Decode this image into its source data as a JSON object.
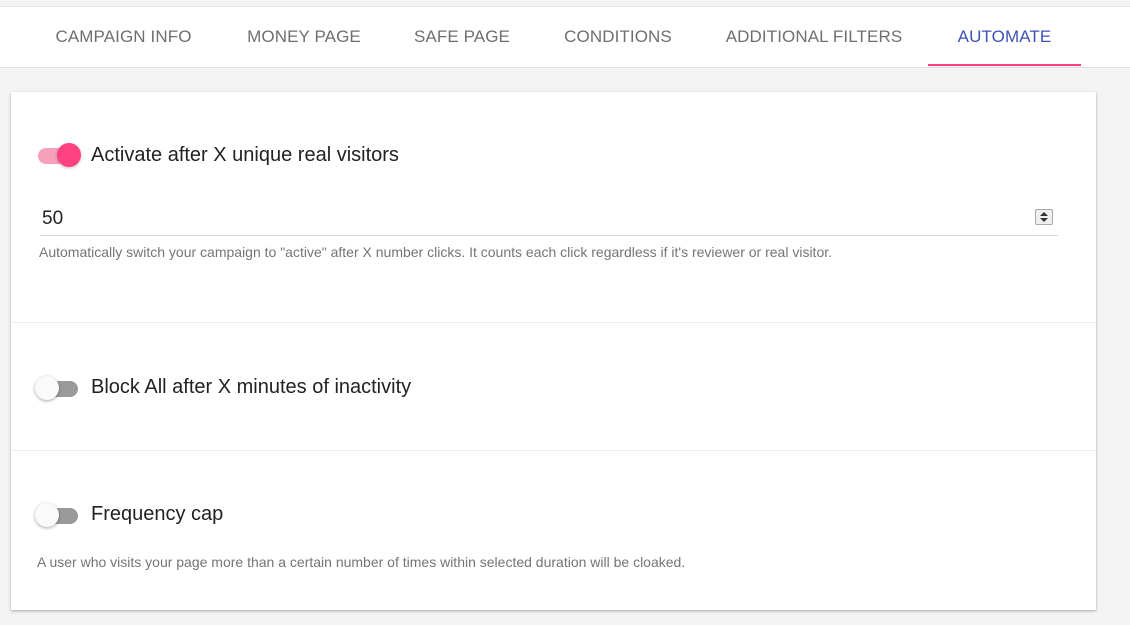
{
  "tabs": [
    {
      "label": "CAMPAIGN INFO"
    },
    {
      "label": "MONEY PAGE"
    },
    {
      "label": "SAFE PAGE"
    },
    {
      "label": "CONDITIONS"
    },
    {
      "label": "ADDITIONAL FILTERS"
    },
    {
      "label": "AUTOMATE"
    }
  ],
  "active_tab": "AUTOMATE",
  "colors": {
    "accent": "#ff4081",
    "primary": "#3f51b5"
  },
  "settings": {
    "activate": {
      "label": "Activate after X unique real visitors",
      "enabled": true,
      "value": "50",
      "helper": "Automatically switch your campaign to \"active\" after X number clicks. It counts each click regardless if it's reviewer or real visitor."
    },
    "block": {
      "label": "Block All after X minutes of inactivity",
      "enabled": false
    },
    "frequency": {
      "label": "Frequency cap",
      "enabled": false,
      "helper": "A user who visits your page more than a certain number of times within selected duration will be cloaked."
    }
  }
}
